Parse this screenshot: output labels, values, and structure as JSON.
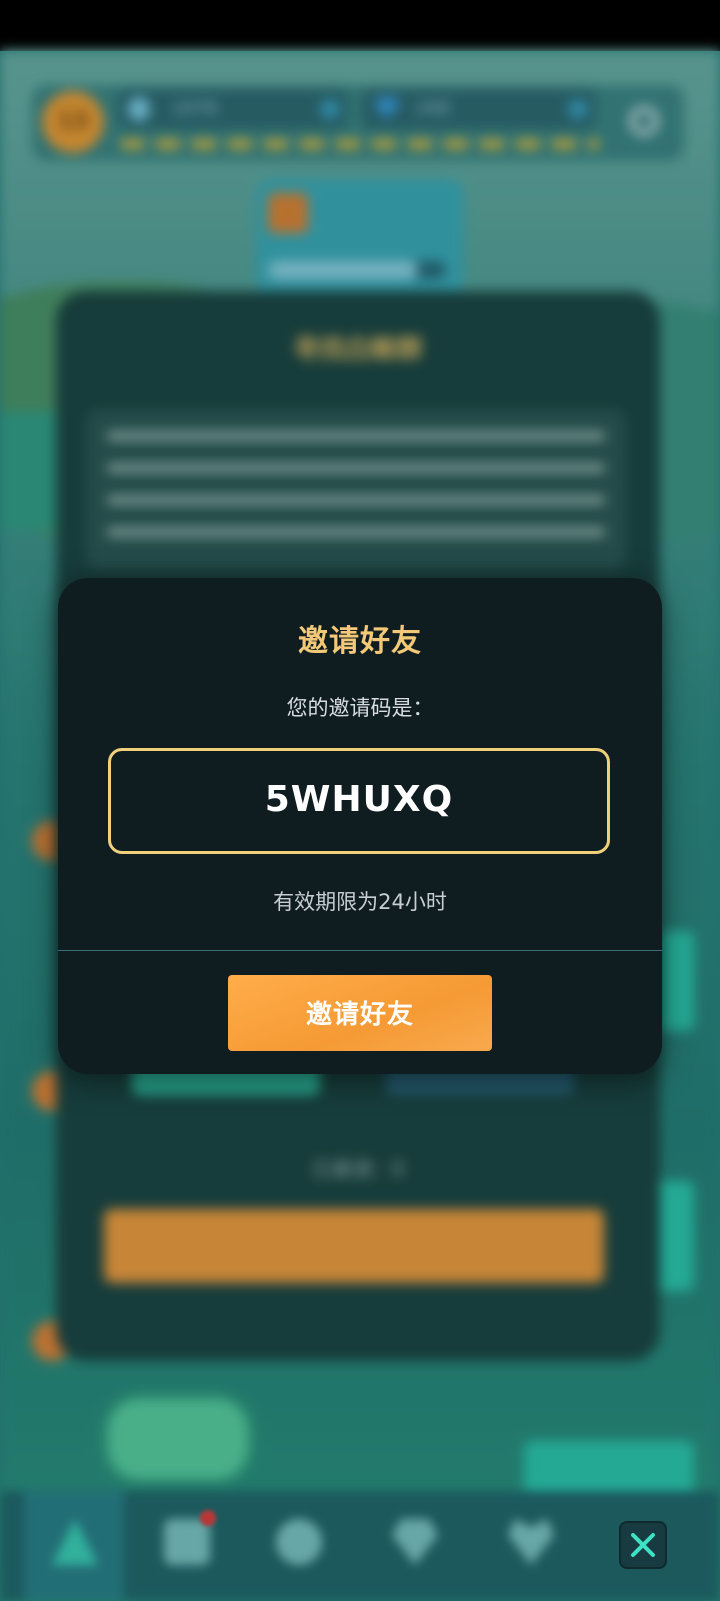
{
  "background": {
    "level": "13",
    "resource_1_value": "1076",
    "resource_2_value": "240",
    "dialog_title": "寻找白鲸群",
    "shown_count_label": "已邀请：0"
  },
  "modal": {
    "title": "邀请好友",
    "subtitle": "您的邀请码是：",
    "invite_code": "5WHUXQ",
    "expiry_note": "有效期限为24小时",
    "invite_button_label": "邀请好友"
  },
  "nav": {
    "items": [
      {
        "icon": "camp-icon",
        "active": true
      },
      {
        "icon": "trophy-icon",
        "active": false,
        "badge": true
      },
      {
        "icon": "compass-icon",
        "active": false
      },
      {
        "icon": "gem-icon",
        "active": false
      },
      {
        "icon": "heart-icon",
        "active": false
      }
    ],
    "close_icon": "close-icon"
  },
  "colors": {
    "modal_bg": "#0f1d21",
    "title_gold": "#f3c978",
    "code_border": "#f1d07a",
    "button_orange": "#f59a35",
    "accent_teal": "#2fc4a8"
  }
}
